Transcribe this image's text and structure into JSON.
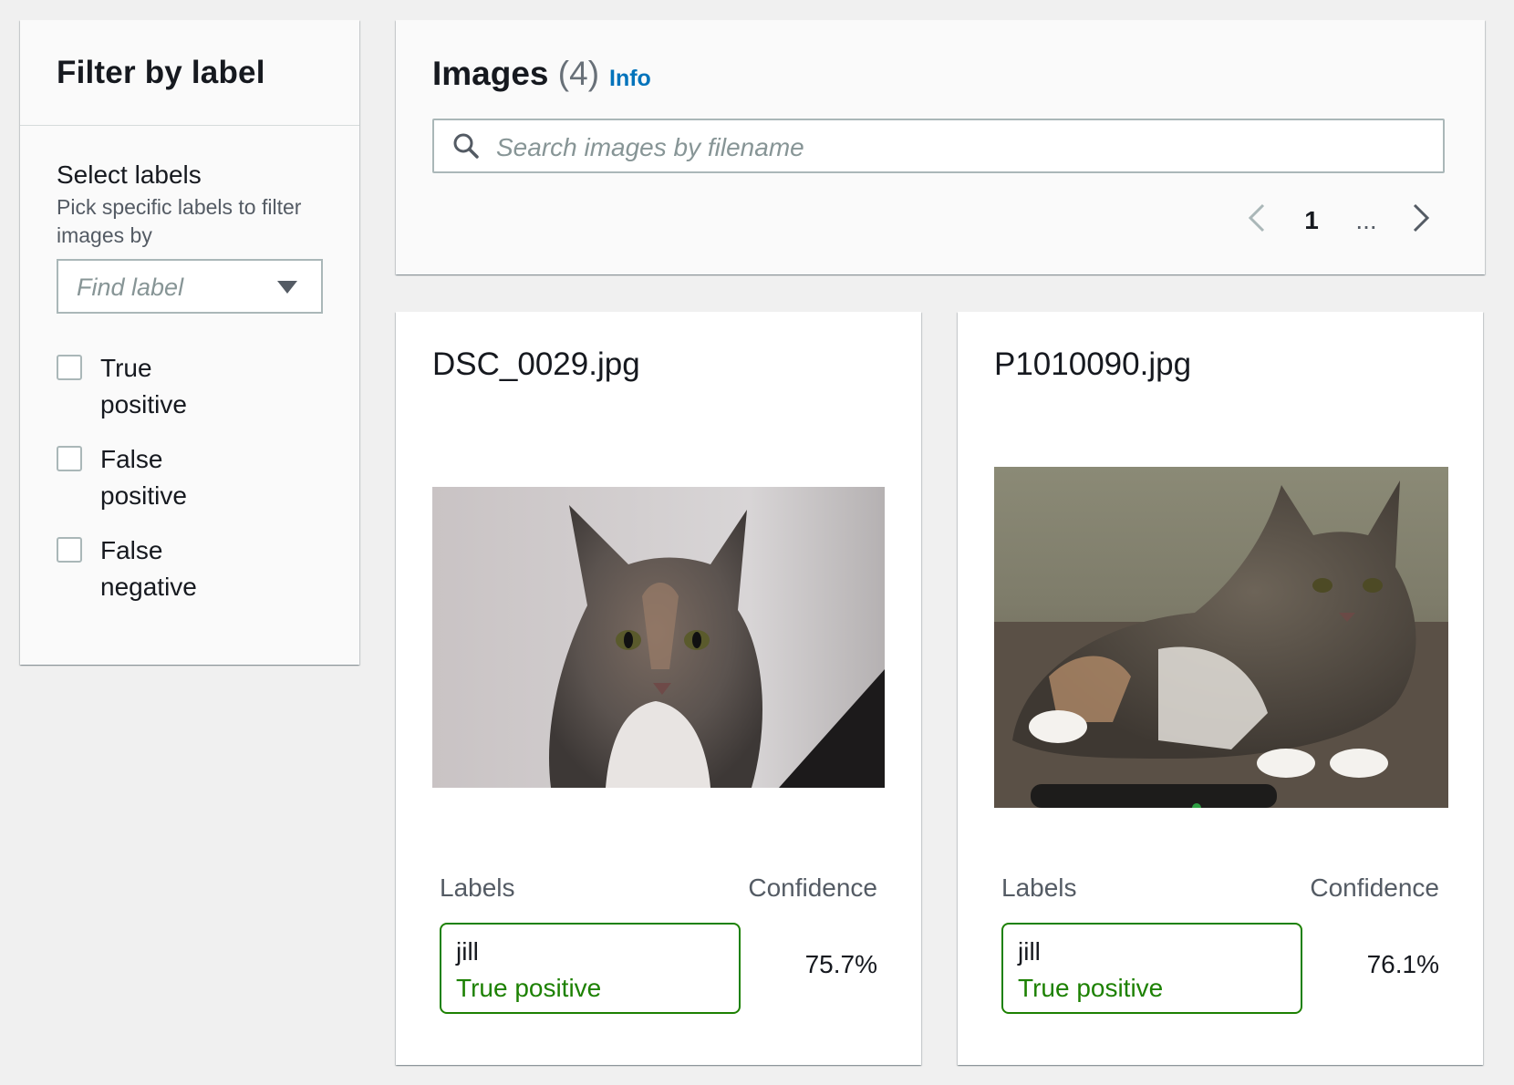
{
  "filter": {
    "title": "Filter by label",
    "select_title": "Select labels",
    "select_desc": "Pick specific labels to filter images by",
    "find_placeholder": "Find label",
    "options": [
      {
        "label": "True positive",
        "checked": false
      },
      {
        "label": "False positive",
        "checked": false
      },
      {
        "label": "False negative",
        "checked": false
      }
    ]
  },
  "images": {
    "title": "Images",
    "count": "(4)",
    "info": "Info",
    "search_placeholder": "Search images by filename",
    "pager": {
      "current": "1",
      "ellipsis": "..."
    }
  },
  "cards": [
    {
      "filename": "DSC_0029.jpg",
      "labels_header": "Labels",
      "confidence_header": "Confidence",
      "label": "jill",
      "status": "True positive",
      "confidence": "75.7%"
    },
    {
      "filename": "P1010090.jpg",
      "labels_header": "Labels",
      "confidence_header": "Confidence",
      "label": "jill",
      "status": "True positive",
      "confidence": "76.1%"
    }
  ],
  "colors": {
    "accent": "#0073bb",
    "positive": "#1d8102"
  }
}
